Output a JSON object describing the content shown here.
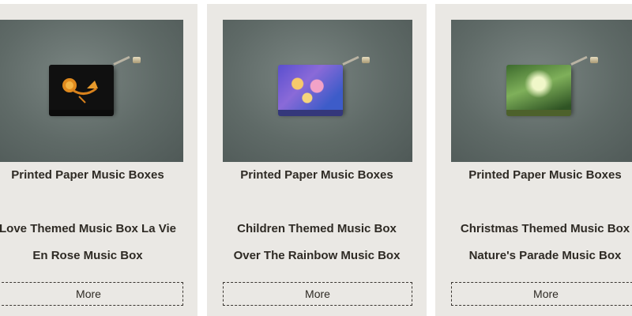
{
  "products": [
    {
      "category": "Printed Paper Music Boxes",
      "title_line_1": "Love Themed Music Box La Vie",
      "title_line_2": "En Rose Music Box",
      "more_label": "More"
    },
    {
      "category": "Printed Paper Music Boxes",
      "title_line_1": "Children Themed Music Box",
      "title_line_2": "Over The Rainbow Music Box",
      "more_label": "More"
    },
    {
      "category": "Printed Paper Music Boxes",
      "title_line_1": "Christmas Themed Music Box",
      "title_line_2": "Nature's Parade Music Box",
      "more_label": "More"
    }
  ]
}
